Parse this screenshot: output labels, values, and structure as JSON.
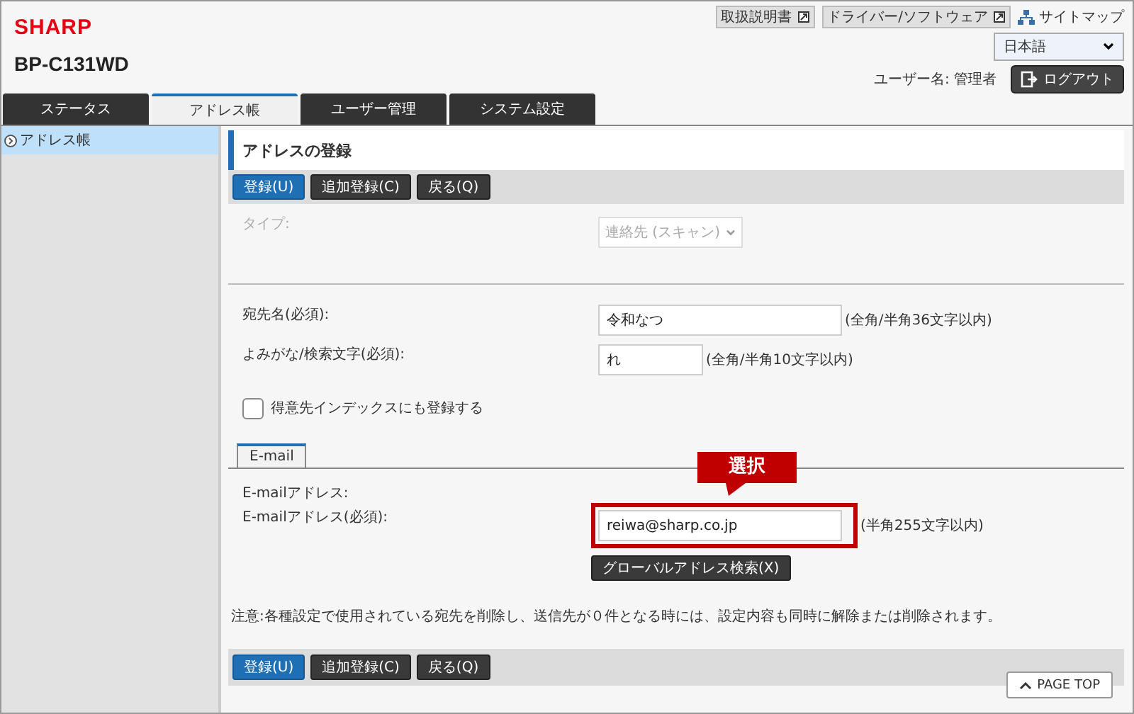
{
  "header": {
    "logo": "SHARP",
    "model": "BP-C131WD",
    "links": [
      {
        "label": "取扱説明書",
        "kind": "external"
      },
      {
        "label": "ドライバー/ソフトウェア",
        "kind": "external"
      },
      {
        "label": "サイトマップ",
        "kind": "sitemap"
      }
    ],
    "language": "日本語",
    "user": "ユーザー名: 管理者",
    "logout": "ログアウト"
  },
  "tabs": [
    {
      "label": "ステータス",
      "selected": false
    },
    {
      "label": "アドレス帳",
      "selected": true
    },
    {
      "label": "ユーザー管理",
      "selected": false
    },
    {
      "label": "システム設定",
      "selected": false
    }
  ],
  "sidebar": {
    "items": [
      {
        "label": "アドレス帳",
        "selected": true
      }
    ]
  },
  "page_title": "アドレスの登録",
  "toolbar": [
    {
      "label": "登録(U)",
      "kind": "primary"
    },
    {
      "label": "追加登録(C)",
      "kind": "dark"
    },
    {
      "label": "戻る(Q)",
      "kind": "dark"
    }
  ],
  "type_field": {
    "label": "タイプ:",
    "value": "連絡先 (スキャン)",
    "disabled": true
  },
  "fields": [
    {
      "label": "宛先名(必須):",
      "value": "令和なつ",
      "hint": "(全角/半角36文字以内)",
      "kind": "wide"
    },
    {
      "label": "よみがな/検索文字(必須):",
      "value": "れ",
      "hint": "(全角/半角10文字以内)",
      "kind": "short"
    }
  ],
  "index_checkbox": {
    "label": "得意先インデックスにも登録する",
    "checked": false
  },
  "subtabs": [
    {
      "label": "E-mail",
      "selected": true
    }
  ],
  "email_heading": "E-mailアドレス:",
  "email_field": {
    "label": "E-mailアドレス(必須):",
    "value": "reiwa@sharp.co.jp",
    "hint": "(半角255文字以内)"
  },
  "global_search": "グローバルアドレス検索(X)",
  "callout": "選択",
  "note": "注意:各種設定で使用されている宛先を削除し、送信先が０件となる時には、設定内容も同時に解除または削除されます。",
  "bottom_toolbar": [
    {
      "label": "登録(U)",
      "kind": "primary"
    },
    {
      "label": "追加登録(C)",
      "kind": "dark"
    },
    {
      "label": "戻る(Q)",
      "kind": "dark"
    }
  ],
  "page_top": "PAGE TOP"
}
